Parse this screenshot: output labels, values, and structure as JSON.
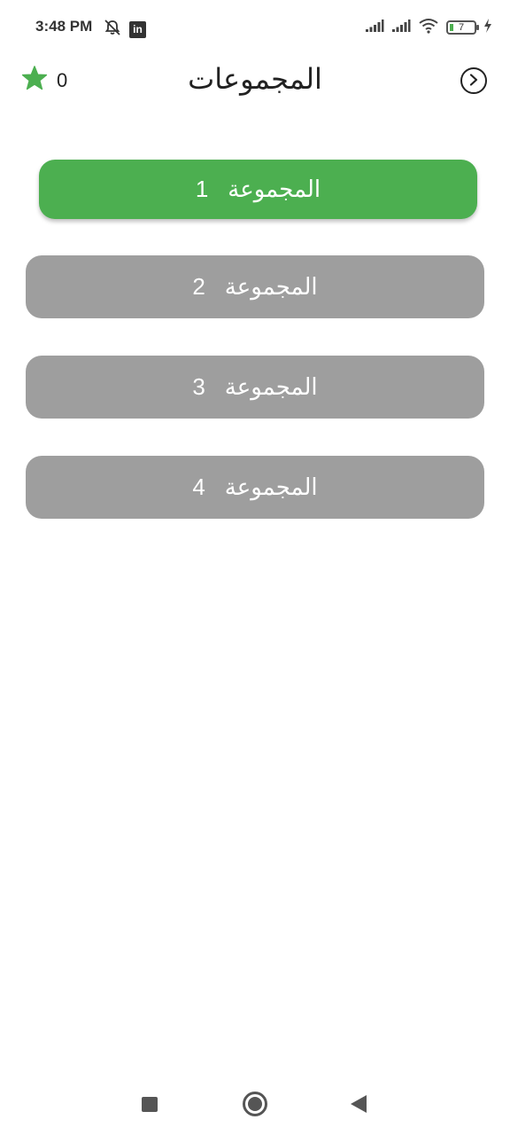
{
  "status_bar": {
    "time": "3:48 PM",
    "battery_level": "7",
    "icons": [
      "alarm-off-icon",
      "linkedin-icon",
      "signal-icon",
      "signal-icon",
      "wifi-icon",
      "battery-icon",
      "charging-icon"
    ]
  },
  "header": {
    "score": "0",
    "title": "المجموعات",
    "star_color": "#4CAF50"
  },
  "groups": [
    {
      "label": "المجموعة",
      "number": "1",
      "state": "active",
      "color": "#4CAF50"
    },
    {
      "label": "المجموعة",
      "number": "2",
      "state": "inactive",
      "color": "#9E9E9E"
    },
    {
      "label": "المجموعة",
      "number": "3",
      "state": "inactive",
      "color": "#9E9E9E"
    },
    {
      "label": "المجموعة",
      "number": "4",
      "state": "inactive",
      "color": "#9E9E9E"
    }
  ],
  "nav": {
    "icons": [
      "recents-icon",
      "home-icon",
      "back-icon"
    ]
  }
}
